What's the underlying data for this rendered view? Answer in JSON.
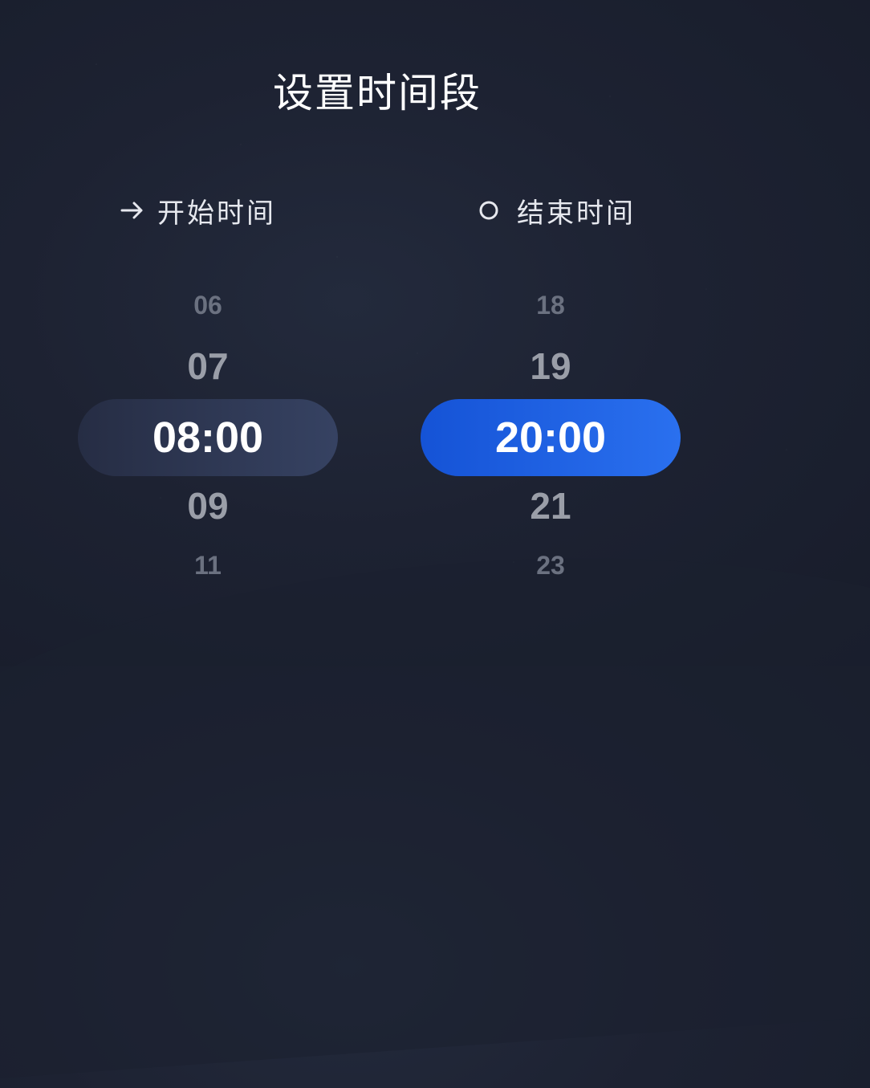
{
  "title": "设置时间段",
  "start": {
    "label": "开始时间",
    "icon": "arrow-right-icon",
    "items": [
      "06",
      "07",
      "08:00",
      "09",
      "11"
    ],
    "selected": "08:00"
  },
  "end": {
    "label": "结束时间",
    "icon": "circle-icon",
    "items": [
      "18",
      "19",
      "20:00",
      "21",
      "23"
    ],
    "selected": "20:00"
  },
  "colors": {
    "background": "#1d2232",
    "accent": "#1f63e6",
    "start_selected_bg": "#2f3852"
  }
}
